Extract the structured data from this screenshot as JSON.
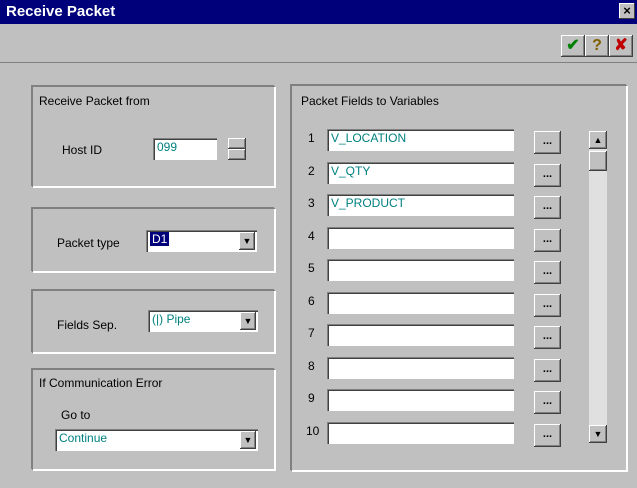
{
  "window": {
    "title": "Receive Packet",
    "close_glyph": "×"
  },
  "toolbar": {
    "ok_glyph": "✔",
    "help_glyph": "?",
    "cancel_glyph": "✘"
  },
  "receive_from": {
    "group_label": "Receive Packet from",
    "host_label": "Host ID",
    "host_value": "099"
  },
  "packet_type": {
    "label": "Packet type",
    "value": "D1"
  },
  "fields_sep": {
    "label": "Fields Sep.",
    "value": "(|)  Pipe"
  },
  "comm_error": {
    "group_label": "If Communication Error",
    "goto_label": "Go to",
    "goto_value": "Continue"
  },
  "packet_fields": {
    "group_label": "Packet Fields to Variables",
    "ellipsis": "...",
    "rows": [
      {
        "num": "1",
        "value": "V_LOCATION"
      },
      {
        "num": "2",
        "value": "V_QTY"
      },
      {
        "num": "3",
        "value": "V_PRODUCT"
      },
      {
        "num": "4",
        "value": ""
      },
      {
        "num": "5",
        "value": ""
      },
      {
        "num": "6",
        "value": ""
      },
      {
        "num": "7",
        "value": ""
      },
      {
        "num": "8",
        "value": ""
      },
      {
        "num": "9",
        "value": ""
      },
      {
        "num": "10",
        "value": ""
      }
    ]
  }
}
